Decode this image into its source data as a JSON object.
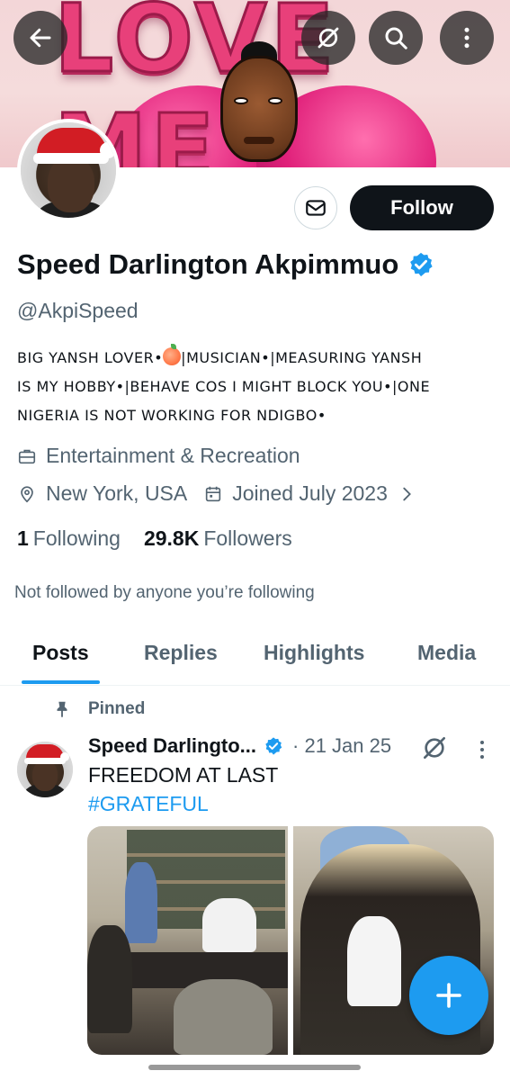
{
  "banner": {
    "text": "LOVE ME"
  },
  "header_buttons": {
    "back": "back-arrow-icon",
    "grok": "grok-icon",
    "search": "search-icon",
    "more": "more-vertical-icon"
  },
  "profile": {
    "name": "Speed Darlington Akpimmuo",
    "handle": "@AkpiSpeed",
    "follow_label": "Follow",
    "bio_line_1a": "BIG YANSH LOVER•",
    "bio_line_1b": "|MUSICIAN•|MEASURING YANSH",
    "bio_line_2": "IS MY HOBBY•|BEHAVE COS I MIGHT BLOCK YOU•|ONE",
    "bio_line_3": "NIGERIA IS NOT WORKING FOR NDIGBO•",
    "category": "Entertainment & Recreation",
    "location": "New York, USA",
    "joined": "Joined July 2023",
    "following_count": "1",
    "following_label": "Following",
    "followers_count": "29.8K",
    "followers_label": "Followers",
    "not_followed_note": "Not followed by anyone you’re following"
  },
  "tabs": [
    {
      "label": "Posts",
      "active": true
    },
    {
      "label": "Replies",
      "active": false
    },
    {
      "label": "Highlights",
      "active": false
    },
    {
      "label": "Media",
      "active": false
    }
  ],
  "pinned_post": {
    "pinned_label": "Pinned",
    "author": "Speed Darlingto...",
    "date": "· 21 Jan 25",
    "text": "FREEDOM AT LAST",
    "hashtag": "#GRATEFUL"
  },
  "colors": {
    "accent": "#1d9bf0",
    "text": "#0f1419",
    "muted": "#536471",
    "follow_bg": "#0f1419"
  }
}
